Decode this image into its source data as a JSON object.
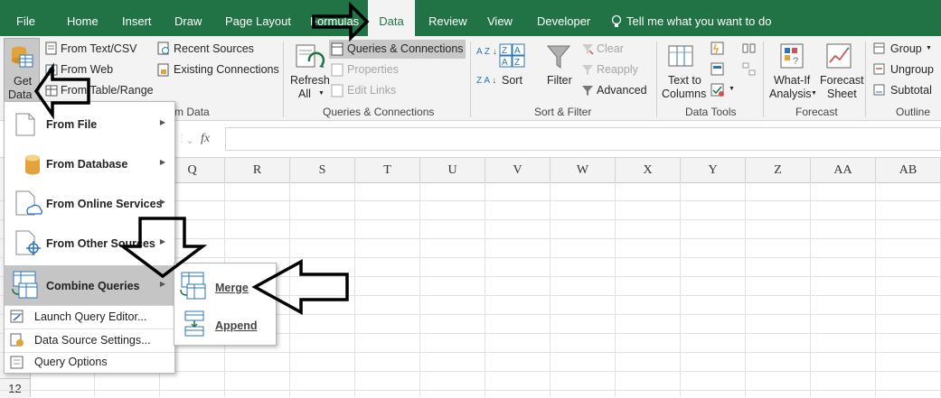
{
  "tabs": [
    {
      "label": "File"
    },
    {
      "label": "Home"
    },
    {
      "label": "Insert"
    },
    {
      "label": "Draw"
    },
    {
      "label": "Page Layout"
    },
    {
      "label": "Formulas"
    },
    {
      "label": "Data"
    },
    {
      "label": "Review"
    },
    {
      "label": "View"
    },
    {
      "label": "Developer"
    }
  ],
  "tell_me": "Tell me what you want to do",
  "ribbon": {
    "get_data_line1": "Get",
    "get_data_line2": "Data",
    "from_text_csv": "From Text/CSV",
    "from_web": "From Web",
    "from_table_range": "From Table/Range",
    "recent_sources": "Recent Sources",
    "existing_connections": "Existing Connections",
    "get_transform_group": "Get & Transform Data",
    "refresh_all_line1": "Refresh",
    "refresh_all_line2": "All",
    "queries_connections": "Queries & Connections",
    "properties": "Properties",
    "edit_links": "Edit Links",
    "queries_group": "Queries & Connections",
    "sort": "Sort",
    "filter": "Filter",
    "clear": "Clear",
    "reapply": "Reapply",
    "advanced": "Advanced",
    "sort_filter_group": "Sort & Filter",
    "text_to_columns_line1": "Text to",
    "text_to_columns_line2": "Columns",
    "data_tools_group": "Data Tools",
    "what_if_line1": "What-If",
    "what_if_line2": "Analysis",
    "forecast_sheet_line1": "Forecast",
    "forecast_sheet_line2": "Sheet",
    "forecast_group": "Forecast",
    "group": "Group",
    "ungroup": "Ungroup",
    "subtotal": "Subtotal",
    "outline_group": "Outline",
    "sort_az": "A Z",
    "sort_za": "Z A"
  },
  "formula_bar": {
    "fx": "fx"
  },
  "columns": [
    "Q",
    "R",
    "S",
    "T",
    "U",
    "V",
    "W",
    "X",
    "Y",
    "Z",
    "AA",
    "AB"
  ],
  "row_number": "12",
  "menu": {
    "from_file": "From File",
    "from_database": "From Database",
    "from_online_services": "From Online Services",
    "from_other_sources": "From Other Sources",
    "combine_queries": "Combine Queries",
    "launch_query_editor": "Launch Query Editor...",
    "data_source_settings": "Data Source Settings...",
    "query_options": "Query Options"
  },
  "submenu": {
    "merge": "Merge",
    "append": "Append"
  },
  "colors": {
    "excel_green": "#217346",
    "ribbon_bg": "#f3f3f3",
    "highlight": "#c5c5c5"
  }
}
